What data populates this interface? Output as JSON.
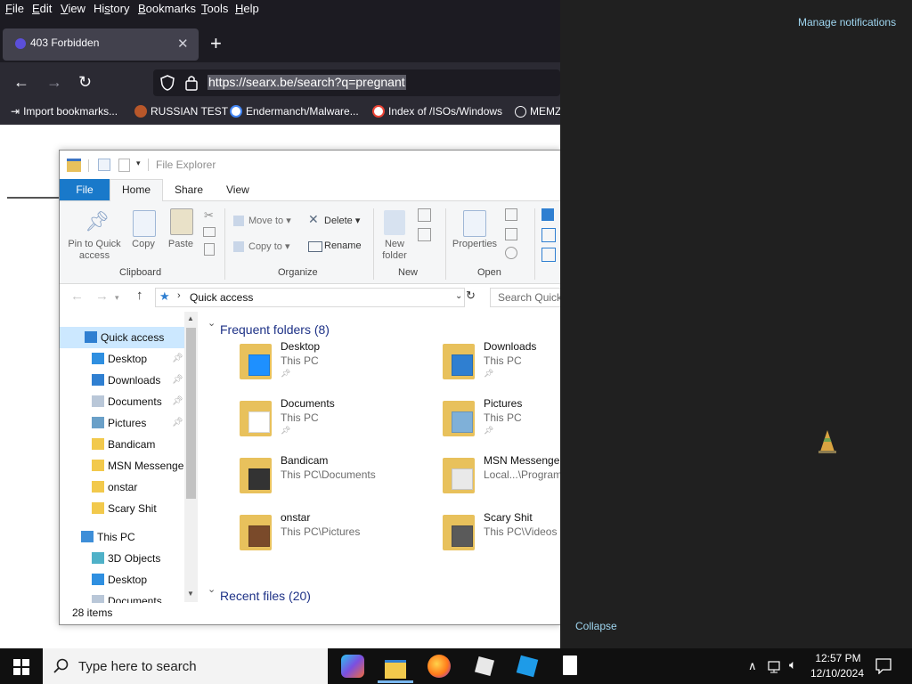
{
  "browser": {
    "menu": [
      {
        "pre": "",
        "u": "F",
        "post": "ile"
      },
      {
        "pre": "",
        "u": "E",
        "post": "dit"
      },
      {
        "pre": "",
        "u": "V",
        "post": "iew"
      },
      {
        "pre": "Hi",
        "u": "s",
        "post": "tory"
      },
      {
        "pre": "",
        "u": "B",
        "post": "ookmarks"
      },
      {
        "pre": "",
        "u": "T",
        "post": "ools"
      },
      {
        "pre": "",
        "u": "H",
        "post": "elp"
      }
    ],
    "tab_title": "403 Forbidden",
    "url": "https://searx.be/search?q=pregnant",
    "bookmarks": [
      "Import bookmarks...",
      "RUSSIAN TEST",
      "Endermanch/Malware...",
      "Index of /ISOs/Windows",
      "MEMZ"
    ]
  },
  "explorer": {
    "title": "File Explorer",
    "ribbon_tabs": [
      "File",
      "Home",
      "Share",
      "View"
    ],
    "clipboard": {
      "pin": "Pin to Quick access",
      "copy": "Copy",
      "paste": "Paste",
      "group": "Clipboard"
    },
    "organize": {
      "move_to": "Move to",
      "delete": "Delete",
      "copy_to": "Copy to",
      "rename": "Rename",
      "group": "Organize"
    },
    "new": {
      "new_folder": "New folder",
      "group": "New"
    },
    "open": {
      "properties": "Properties",
      "group": "Open"
    },
    "address": "Quick access",
    "search_placeholder": "Search Quick access",
    "nav": [
      {
        "label": "Quick access",
        "pinned": false,
        "icon": "star-icon"
      },
      {
        "label": "Desktop",
        "pinned": true,
        "icon": "desktop-icon"
      },
      {
        "label": "Downloads",
        "pinned": true,
        "icon": "download-icon"
      },
      {
        "label": "Documents",
        "pinned": true,
        "icon": "documents-icon"
      },
      {
        "label": "Pictures",
        "pinned": true,
        "icon": "pictures-icon"
      },
      {
        "label": "Bandicam",
        "pinned": false,
        "icon": "folder-icon"
      },
      {
        "label": "MSN Messenger",
        "pinned": false,
        "icon": "folder-icon"
      },
      {
        "label": "onstar",
        "pinned": false,
        "icon": "folder-icon"
      },
      {
        "label": "Scary Shit",
        "pinned": false,
        "icon": "folder-icon"
      },
      {
        "label": "This PC",
        "pinned": false,
        "icon": "computer-icon"
      },
      {
        "label": "3D Objects",
        "pinned": false,
        "icon": "cube-icon"
      },
      {
        "label": "Desktop",
        "pinned": false,
        "icon": "desktop-icon"
      },
      {
        "label": "Documents",
        "pinned": false,
        "icon": "documents-icon"
      }
    ],
    "frequent_header": "Frequent folders (8)",
    "recent_header": "Recent files (20)",
    "folders": [
      {
        "name": "Desktop",
        "path": "This PC",
        "pinned": true
      },
      {
        "name": "Downloads",
        "path": "This PC",
        "pinned": true
      },
      {
        "name": "Documents",
        "path": "This PC",
        "pinned": true
      },
      {
        "name": "Pictures",
        "path": "This PC",
        "pinned": true
      },
      {
        "name": "Bandicam",
        "path": "This PC\\Documents",
        "pinned": false
      },
      {
        "name": "MSN Messenger",
        "path": "Local...\\Program",
        "pinned": false
      },
      {
        "name": "onstar",
        "path": "This PC\\Pictures",
        "pinned": false
      },
      {
        "name": "Scary Shit",
        "path": "This PC\\Videos",
        "pinned": false
      }
    ],
    "status": "28 items"
  },
  "notifications": {
    "manage": "Manage notifications",
    "collapse": "Collapse"
  },
  "taskbar": {
    "search_placeholder": "Type here to search",
    "time": "12:57 PM",
    "date": "12/10/2024"
  }
}
